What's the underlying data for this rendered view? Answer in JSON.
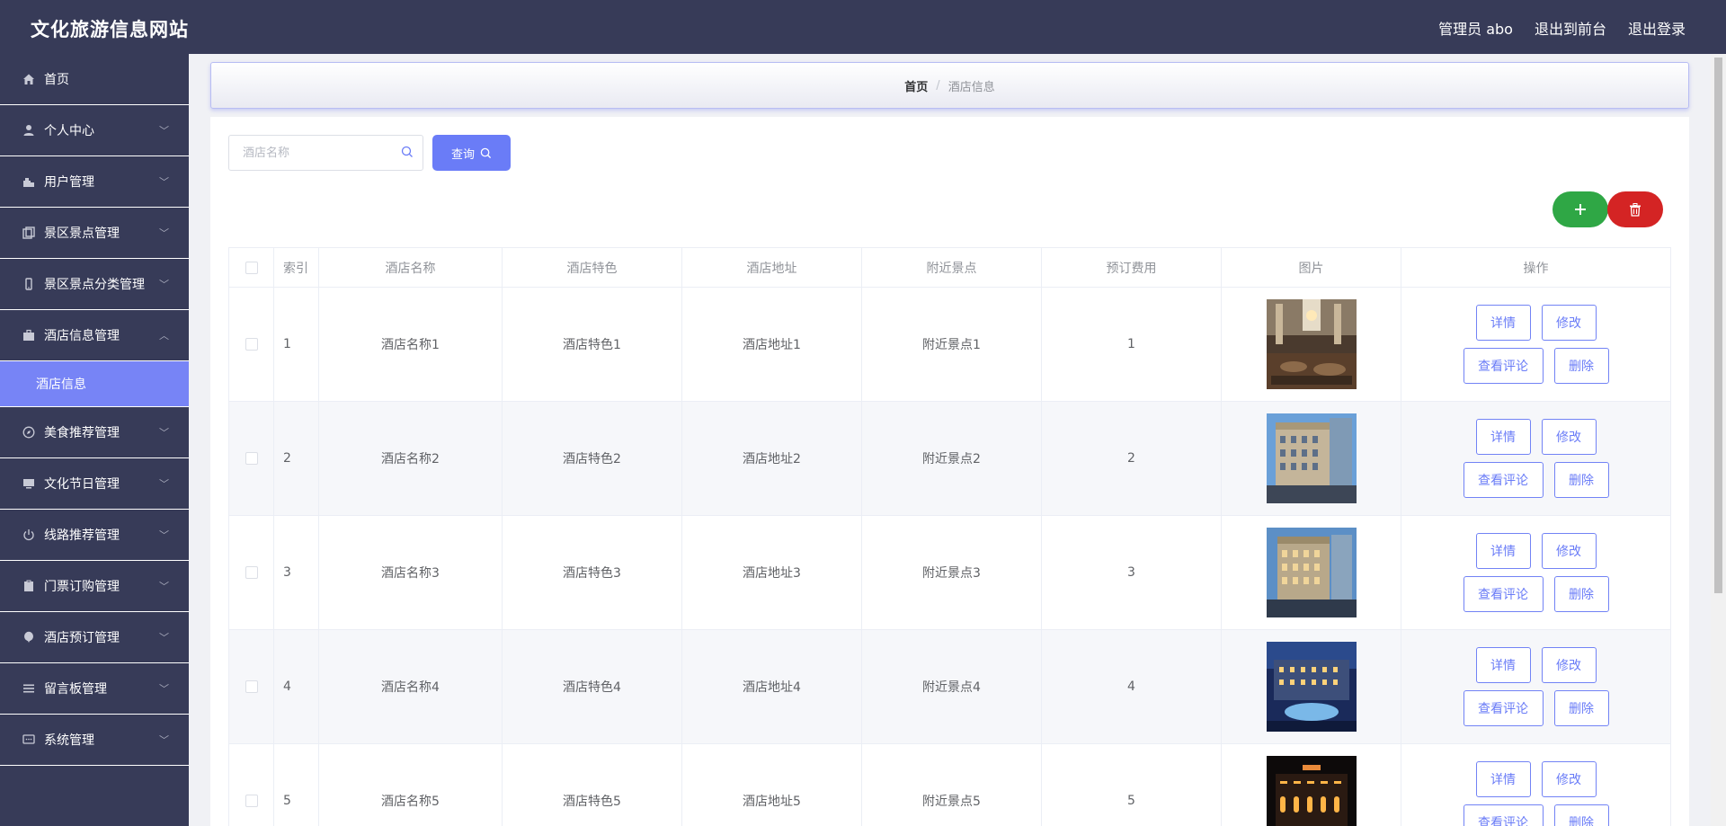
{
  "header": {
    "site_title": "文化旅游信息网站",
    "admin_label": "管理员 abo",
    "to_frontend": "退出到前台",
    "logout": "退出登录"
  },
  "sidebar": {
    "items": [
      {
        "label": "首页",
        "icon": "home-icon",
        "expandable": false
      },
      {
        "label": "个人中心",
        "icon": "user-icon",
        "expandable": true
      },
      {
        "label": "用户管理",
        "icon": "users-icon",
        "expandable": true
      },
      {
        "label": "景区景点管理",
        "icon": "copy-icon",
        "expandable": true
      },
      {
        "label": "景区景点分类管理",
        "icon": "phone-icon",
        "expandable": true
      },
      {
        "label": "酒店信息管理",
        "icon": "briefcase-icon",
        "expandable": true,
        "expanded": true
      },
      {
        "label": "美食推荐管理",
        "icon": "compass-icon",
        "expandable": true
      },
      {
        "label": "文化节日管理",
        "icon": "monitor-icon",
        "expandable": true
      },
      {
        "label": "线路推荐管理",
        "icon": "power-icon",
        "expandable": true
      },
      {
        "label": "门票订购管理",
        "icon": "clipboard-icon",
        "expandable": true
      },
      {
        "label": "酒店预订管理",
        "icon": "balloon-icon",
        "expandable": true
      },
      {
        "label": "留言板管理",
        "icon": "list-icon",
        "expandable": true
      },
      {
        "label": "系统管理",
        "icon": "chat-icon",
        "expandable": true
      }
    ],
    "active_sub": "酒店信息"
  },
  "breadcrumb": {
    "home": "首页",
    "separator": "/",
    "current": "酒店信息"
  },
  "search": {
    "placeholder": "酒店名称",
    "button": "查询"
  },
  "table": {
    "headers": [
      "",
      "索引",
      "酒店名称",
      "酒店特色",
      "酒店地址",
      "附近景点",
      "预订费用",
      "图片",
      "操作"
    ],
    "rows": [
      {
        "index": "1",
        "name": "酒店名称1",
        "feature": "酒店特色1",
        "address": "酒店地址1",
        "nearby": "附近景点1",
        "fee": "1",
        "image": "hotel-lobby"
      },
      {
        "index": "2",
        "name": "酒店名称2",
        "feature": "酒店特色2",
        "address": "酒店地址2",
        "nearby": "附近景点2",
        "fee": "2",
        "image": "hotel-building-day"
      },
      {
        "index": "3",
        "name": "酒店名称3",
        "feature": "酒店特色3",
        "address": "酒店地址3",
        "nearby": "附近景点3",
        "fee": "3",
        "image": "hotel-building-dusk"
      },
      {
        "index": "4",
        "name": "酒店名称4",
        "feature": "酒店特色4",
        "address": "酒店地址4",
        "nearby": "附近景点4",
        "fee": "4",
        "image": "hotel-fountain-night"
      },
      {
        "index": "5",
        "name": "酒店名称5",
        "feature": "酒店特色5",
        "address": "酒店地址5",
        "nearby": "附近景点5",
        "fee": "5",
        "image": "hotel-facade-night"
      }
    ],
    "ops": {
      "detail": "详情",
      "edit": "修改",
      "comments": "查看评论",
      "delete": "删除"
    }
  },
  "colors": {
    "header_bg": "#373b58",
    "accent": "#6a7cf7",
    "add_green": "#2fa745",
    "delete_red": "#d42424"
  }
}
